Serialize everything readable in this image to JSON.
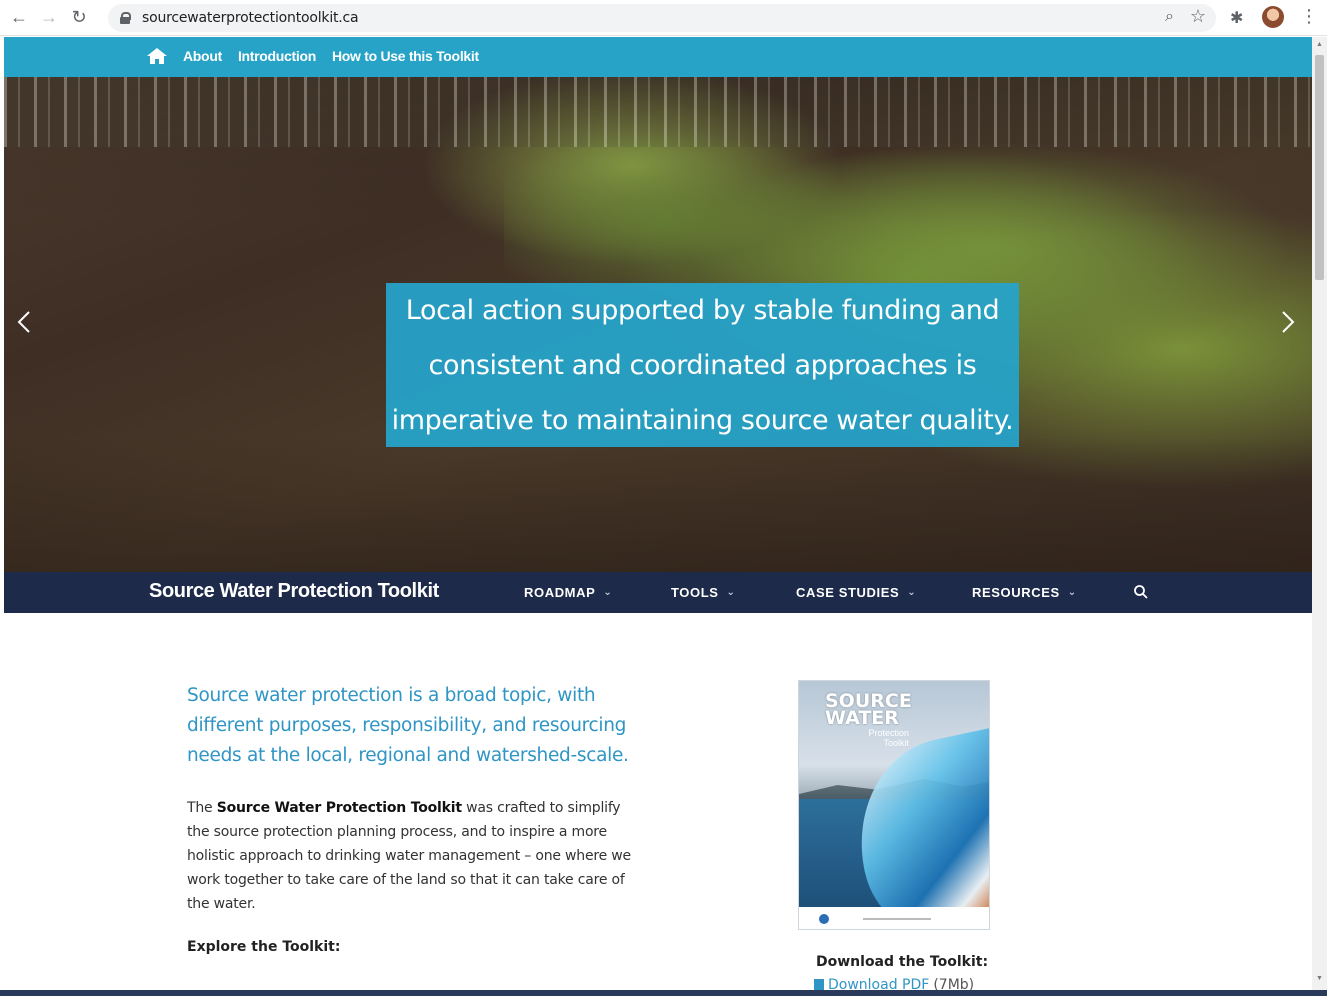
{
  "browser": {
    "url": "sourcewaterprotectiontoolkit.ca",
    "icons": [
      "back-arrow-icon",
      "forward-arrow-icon",
      "reload-icon",
      "lock-icon",
      "zoom-icon",
      "bookmark-star-icon",
      "extensions-puzzle-icon",
      "profile-avatar",
      "menu-kebab-icon"
    ]
  },
  "topbar": {
    "links": [
      "About",
      "Introduction",
      "How to Use this Toolkit"
    ],
    "bg_color": "#27a3c7"
  },
  "hero": {
    "caption_lines": [
      "Local action supported by stable funding and",
      "consistent and coordinated approaches is",
      "imperative to maintaining source water quality."
    ],
    "caption_bg": "#26a2c8"
  },
  "mainnav": {
    "brand": "Source Water Protection Toolkit",
    "items": [
      "ROADMAP",
      "TOOLS",
      "CASE STUDIES",
      "RESOURCES"
    ],
    "bg_color": "#1d2a4a"
  },
  "content": {
    "lead": "Source water protection is a broad topic, with different purposes, responsibility, and resourcing needs at the local, regional and watershed-scale.",
    "body_prefix": "The ",
    "body_bold": "Source Water Protection Toolkit",
    "body_rest": " was crafted to simplify the source protection planning process, and to inspire a more holistic approach to drinking water management – one where we work together to take care of the land so that it can take care of the water.",
    "explore": "Explore the Toolkit:"
  },
  "cover": {
    "title": "SOURCE WATER",
    "subtitle": "Protection Toolkit"
  },
  "download": {
    "title": "Download the Toolkit:",
    "link": "Download PDF",
    "size": "(7Mb)"
  }
}
